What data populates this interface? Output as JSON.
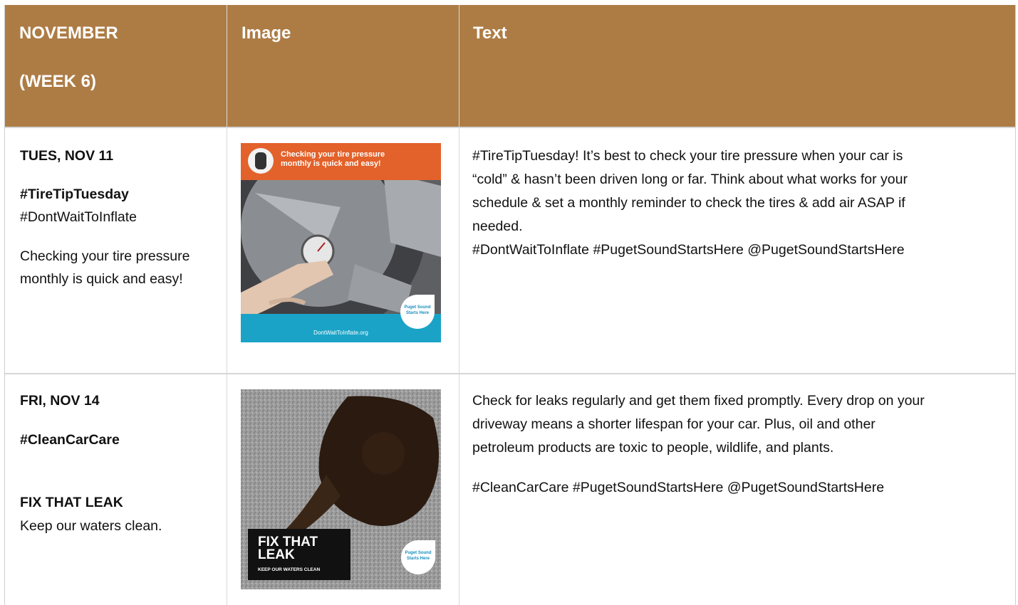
{
  "header": {
    "col1_line1": "NOVEMBER",
    "col1_line2": "(WEEK 6)",
    "col2": "Image",
    "col3": "Text",
    "color": "#ad7c45"
  },
  "rows": [
    {
      "date": "TUES, NOV 11",
      "hashtag_bold": "#TireTipTuesday",
      "hashtag2": "#DontWaitToInflate",
      "desc_line1": "Checking your tire pressure",
      "desc_line2": "monthly is quick and easy!",
      "image": {
        "banner_line1": "Checking your tire pressure",
        "banner_line2": "monthly is quick and easy!",
        "logo_line1": "Puget Sound",
        "logo_line2": "Starts Here",
        "footer_url": "DontWaitToInflate.org"
      },
      "text_lines": [
        "#TireTipTuesday! It’s best to check your tire pressure when your car is",
        "“cold” & hasn’t been driven long or far. Think about what works for your",
        "schedule & set a monthly reminder to check the tires & add air ASAP if",
        "needed.",
        "#DontWaitToInflate #PugetSoundStartsHere @PugetSoundStartsHere"
      ]
    },
    {
      "date": "FRI, NOV 14",
      "hashtag_bold": "#CleanCarCare",
      "title": "FIX THAT LEAK",
      "subtitle": "Keep our waters clean.",
      "image": {
        "headline_line1": "FIX THAT",
        "headline_line2": "LEAK",
        "tagline": "KEEP OUR WATERS CLEAN",
        "logo_line1": "Puget Sound",
        "logo_line2": "Starts Here"
      },
      "text_lines": [
        "Check for leaks regularly and get them fixed promptly. Every drop on your",
        "driveway means a shorter lifespan for your car. Plus, oil and other",
        "petroleum products are toxic to people, wildlife, and plants.",
        "#CleanCarCare #PugetSoundStartsHere @PugetSoundStartsHere"
      ]
    }
  ]
}
